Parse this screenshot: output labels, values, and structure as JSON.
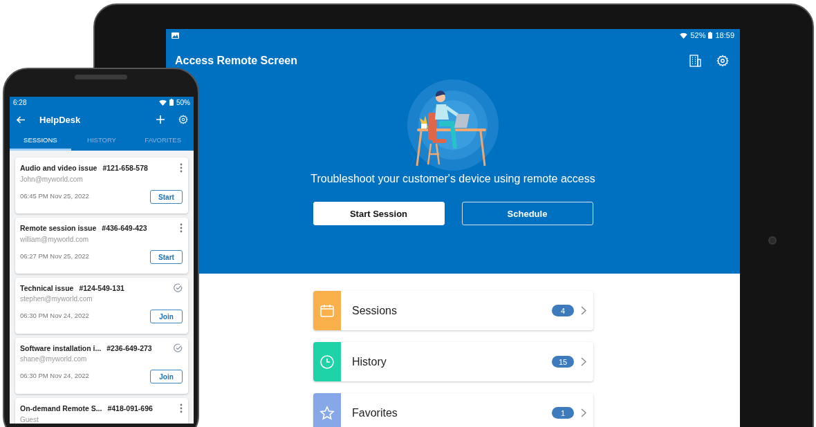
{
  "tablet": {
    "status_bar": {
      "battery": "52%",
      "time": "18:59"
    },
    "app_bar": {
      "title": "Access Remote Screen"
    },
    "hero": {
      "message": "Troubleshoot your customer's device using remote access",
      "buttons": [
        {
          "label": "Start Session",
          "kind": "primary"
        },
        {
          "label": "Schedule",
          "kind": "outline"
        }
      ]
    },
    "menu": [
      {
        "label": "Sessions",
        "count": "4",
        "color": "#f9b04a",
        "kind": "calendar"
      },
      {
        "label": "History",
        "count": "15",
        "color": "#1dd3a7",
        "kind": "clock"
      },
      {
        "label": "Favorites",
        "count": "1",
        "color": "#86a8e8",
        "kind": "star"
      }
    ]
  },
  "phone": {
    "status_bar": {
      "time": "6:28",
      "battery": "50%"
    },
    "app_bar": {
      "title": "HelpDesk"
    },
    "tabs": [
      {
        "label": "SESSIONS",
        "selected": true
      },
      {
        "label": "HISTORY",
        "selected": false
      },
      {
        "label": "FAVORITES",
        "selected": false
      }
    ],
    "sessions": [
      {
        "title": "Audio and video issue",
        "code": "#121-658-578",
        "email": "John@myworld.com",
        "time": "06:45 PM Nov 25, 2022",
        "action": "Start",
        "kind": "menu"
      },
      {
        "title": "Remote session issue",
        "code": "#436-649-423",
        "email": "william@myworld.com",
        "time": "06:27 PM Nov 25, 2022",
        "action": "Start",
        "kind": "menu"
      },
      {
        "title": "Technical issue",
        "code": "#124-549-131",
        "email": "stephen@myworld.com",
        "time": "06:30 PM Nov 24, 2022",
        "action": "Join",
        "kind": "done"
      },
      {
        "title": "Software installation i...",
        "code": "#236-649-273",
        "email": "shane@myworld.com",
        "time": "06:30 PM Nov 24, 2022",
        "action": "Join",
        "kind": "done"
      },
      {
        "title": "On-demand Remote S...",
        "code": "#418-091-696",
        "email": "Guest",
        "kind": "menu"
      }
    ]
  }
}
